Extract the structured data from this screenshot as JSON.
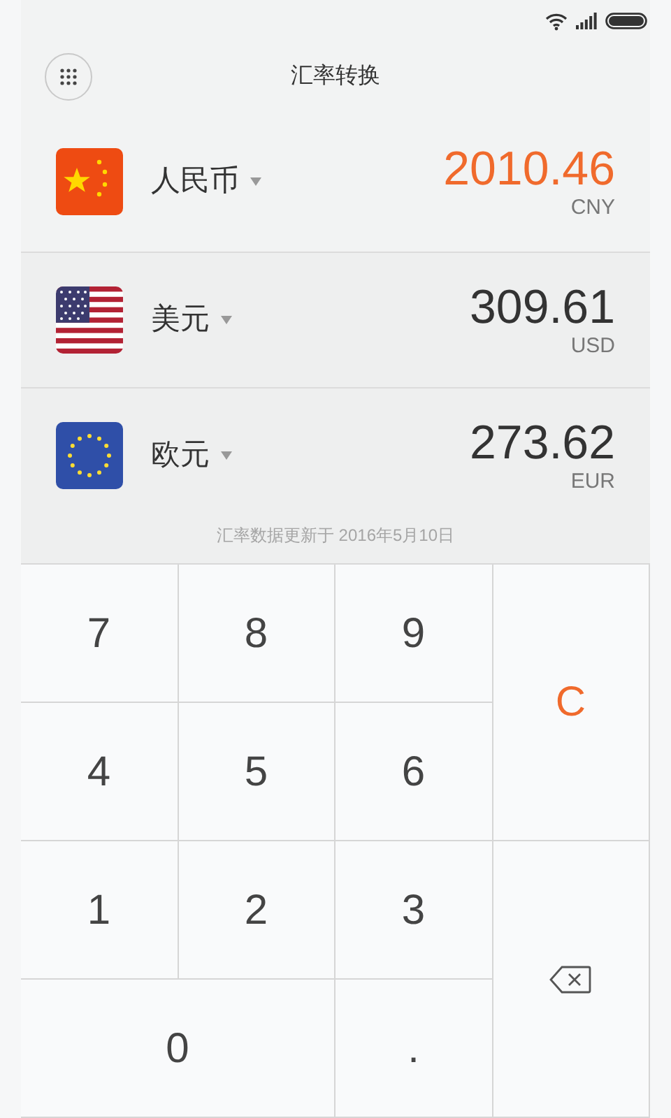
{
  "header": {
    "title": "汇率转换"
  },
  "currencies": [
    {
      "name": "人民币",
      "value": "2010.46",
      "code": "CNY",
      "selected": true
    },
    {
      "name": "美元",
      "value": "309.61",
      "code": "USD",
      "selected": false
    },
    {
      "name": "欧元",
      "value": "273.62",
      "code": "EUR",
      "selected": false
    }
  ],
  "update_note": "汇率数据更新于 2016年5月10日",
  "keys": [
    {
      "kind": "digit",
      "label": "7"
    },
    {
      "kind": "digit",
      "label": "8"
    },
    {
      "kind": "digit",
      "label": "9"
    },
    {
      "kind": "clear",
      "label": "C"
    },
    {
      "kind": "digit",
      "label": "4"
    },
    {
      "kind": "digit",
      "label": "5"
    },
    {
      "kind": "digit",
      "label": "6"
    },
    {
      "kind": "digit",
      "label": "1"
    },
    {
      "kind": "digit",
      "label": "2"
    },
    {
      "kind": "digit",
      "label": "3"
    },
    {
      "kind": "backspace"
    },
    {
      "kind": "digit",
      "label": "0"
    },
    {
      "kind": "digit",
      "label": "."
    }
  ]
}
